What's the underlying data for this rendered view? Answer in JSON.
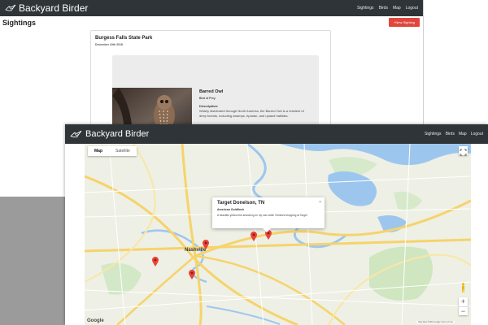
{
  "app": {
    "brand": "Backyard Birder"
  },
  "nav_links": [
    "Sightings",
    "Birds",
    "Map",
    "Logout"
  ],
  "sightings_page": {
    "title": "Sightings",
    "new_button": "+New Sighting",
    "sighting": {
      "park": "Burgess Falls State Park",
      "date": "December 10th 2018",
      "bird_name": "Barred Owl",
      "category": "Bird of Prey",
      "description_label": "Description:",
      "description": "Widely distributed through North America, the Barred Owl is a resident of deep forests, including swamps, riparian, and upland habitats."
    }
  },
  "map_page": {
    "map_types": [
      "Map",
      "Satellite"
    ],
    "active_map_type": "Map",
    "zoom_in": "+",
    "zoom_out": "−",
    "city_label": "Nashville",
    "infowindow": {
      "title": "Target Donelson, TN",
      "bird": "American Goldfinch",
      "description": "A beautiful yellow bird searching on my own while I finished shopping at Target",
      "close": "×"
    },
    "attribution": "Google",
    "terms": "Map data ©2019 Google  Terms of Use",
    "marker_count": 5
  },
  "colors": {
    "navbar": "#2f3438",
    "button_red": "#e0463c",
    "marker_red": "#ea4335",
    "water": "#9dc6ef",
    "highway": "#f6d36b"
  }
}
